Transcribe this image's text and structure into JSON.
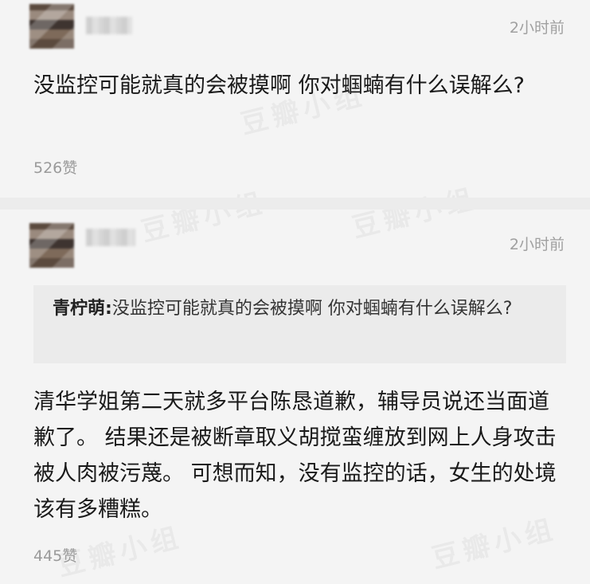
{
  "watermark": "豆瓣小组",
  "comments": [
    {
      "time": "2小时前",
      "content": "没监控可能就真的会被摸啊 你对蝈蝻有什么误解么?",
      "likes": "526赞"
    },
    {
      "time": "2小时前",
      "quote": {
        "name": "青柠萌:",
        "text": "没监控可能就真的会被摸啊 你对蝈蝻有什么误解么?"
      },
      "content": "清华学姐第二天就多平台陈恳道歉，辅导员说还当面道歉了。 结果还是被断章取义胡搅蛮缠放到网上人身攻击被人肉被污蔑。 可想而知，没有监控的话，女生的处境该有多糟糕。",
      "likes": "445赞"
    }
  ]
}
